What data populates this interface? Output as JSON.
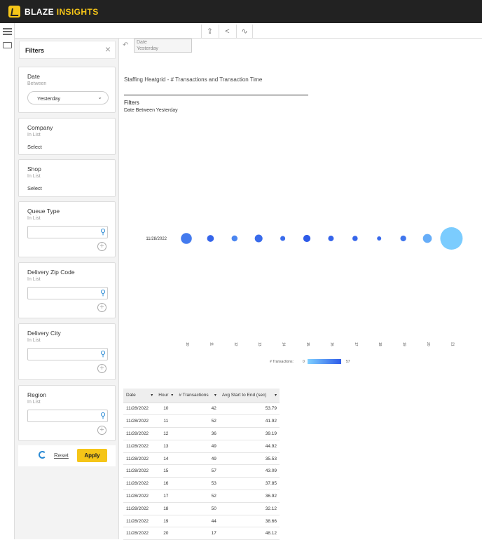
{
  "app": {
    "brand_a": "BLAZE",
    "brand_b": "INSIGHTS"
  },
  "toolbar": {
    "export_icon": "upload-icon",
    "share_icon": "share-icon",
    "feed_icon": "rss-icon"
  },
  "filters_panel": {
    "title": "Filters",
    "cards": [
      {
        "title": "Date",
        "sub": "Between",
        "value": "Yesterday"
      },
      {
        "title": "Company",
        "sub": "In List",
        "value": "Select"
      },
      {
        "title": "Shop",
        "sub": "In List",
        "value": "Select"
      },
      {
        "title": "Queue Type",
        "sub": "In List"
      },
      {
        "title": "Delivery Zip Code",
        "sub": "In List"
      },
      {
        "title": "Delivery City",
        "sub": "In List"
      },
      {
        "title": "Region",
        "sub": "In List"
      }
    ],
    "reset_label": "Reset",
    "apply_label": "Apply"
  },
  "filter_chip": {
    "label": "Date",
    "value": "Yesterday"
  },
  "report": {
    "title": "Staffing Heatgrid - # Transactions and Transaction Time",
    "filters_heading": "Filters",
    "filters_desc": "Date Between Yesterday"
  },
  "chart_data": {
    "type": "scatter",
    "row_label": "11/28/2022",
    "x": [
      "10",
      "11",
      "12",
      "13",
      "14",
      "15",
      "16",
      "17",
      "18",
      "19",
      "20",
      "21"
    ],
    "values": [
      42,
      52,
      36,
      49,
      49,
      57,
      53,
      52,
      50,
      44,
      17,
      2
    ],
    "avg_time": [
      53.79,
      41.92,
      39.19,
      44.92,
      35.53,
      43.09,
      37.85,
      36.92,
      32.12,
      38.66,
      48.12,
      82
    ],
    "legend_label": "# Transactions:",
    "legend_min": "0",
    "legend_max": "57",
    "colors": {
      "low": "#7ed0ff",
      "high": "#2e5be8"
    }
  },
  "table": {
    "headers": [
      "Date",
      "Hour",
      "# Transactions",
      "Avg Start to End (sec)"
    ],
    "rows": [
      [
        "11/28/2022",
        "10",
        "42",
        "53.79"
      ],
      [
        "11/28/2022",
        "11",
        "52",
        "41.92"
      ],
      [
        "11/28/2022",
        "12",
        "36",
        "39.19"
      ],
      [
        "11/28/2022",
        "13",
        "49",
        "44.92"
      ],
      [
        "11/28/2022",
        "14",
        "49",
        "35.53"
      ],
      [
        "11/28/2022",
        "15",
        "57",
        "43.09"
      ],
      [
        "11/28/2022",
        "16",
        "53",
        "37.85"
      ],
      [
        "11/28/2022",
        "17",
        "52",
        "36.92"
      ],
      [
        "11/28/2022",
        "18",
        "50",
        "32.12"
      ],
      [
        "11/28/2022",
        "19",
        "44",
        "38.66"
      ],
      [
        "11/28/2022",
        "20",
        "17",
        "48.12"
      ]
    ]
  }
}
